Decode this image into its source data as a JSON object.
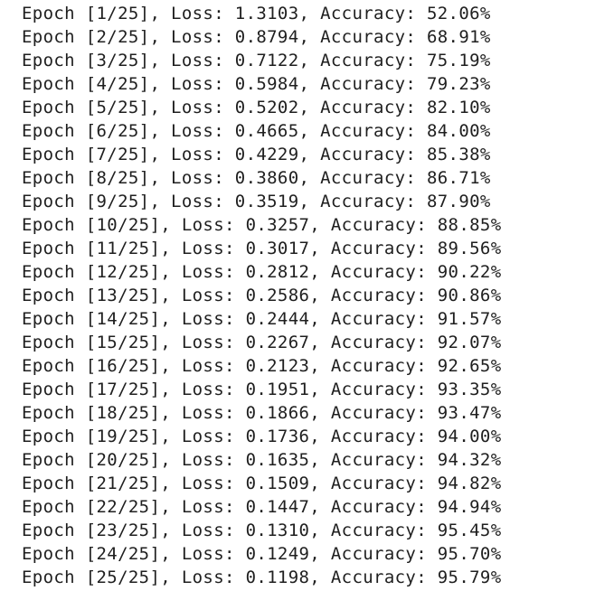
{
  "output": {
    "lines": [
      "Epoch [1/25], Loss: 1.3103, Accuracy: 52.06%",
      "Epoch [2/25], Loss: 0.8794, Accuracy: 68.91%",
      "Epoch [3/25], Loss: 0.7122, Accuracy: 75.19%",
      "Epoch [4/25], Loss: 0.5984, Accuracy: 79.23%",
      "Epoch [5/25], Loss: 0.5202, Accuracy: 82.10%",
      "Epoch [6/25], Loss: 0.4665, Accuracy: 84.00%",
      "Epoch [7/25], Loss: 0.4229, Accuracy: 85.38%",
      "Epoch [8/25], Loss: 0.3860, Accuracy: 86.71%",
      "Epoch [9/25], Loss: 0.3519, Accuracy: 87.90%",
      "Epoch [10/25], Loss: 0.3257, Accuracy: 88.85%",
      "Epoch [11/25], Loss: 0.3017, Accuracy: 89.56%",
      "Epoch [12/25], Loss: 0.2812, Accuracy: 90.22%",
      "Epoch [13/25], Loss: 0.2586, Accuracy: 90.86%",
      "Epoch [14/25], Loss: 0.2444, Accuracy: 91.57%",
      "Epoch [15/25], Loss: 0.2267, Accuracy: 92.07%",
      "Epoch [16/25], Loss: 0.2123, Accuracy: 92.65%",
      "Epoch [17/25], Loss: 0.1951, Accuracy: 93.35%",
      "Epoch [18/25], Loss: 0.1866, Accuracy: 93.47%",
      "Epoch [19/25], Loss: 0.1736, Accuracy: 94.00%",
      "Epoch [20/25], Loss: 0.1635, Accuracy: 94.32%",
      "Epoch [21/25], Loss: 0.1509, Accuracy: 94.82%",
      "Epoch [22/25], Loss: 0.1447, Accuracy: 94.94%",
      "Epoch [23/25], Loss: 0.1310, Accuracy: 95.45%",
      "Epoch [24/25], Loss: 0.1249, Accuracy: 95.70%",
      "Epoch [25/25], Loss: 0.1198, Accuracy: 95.79%"
    ]
  }
}
